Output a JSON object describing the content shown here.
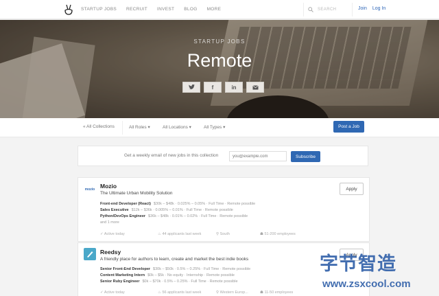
{
  "nav": {
    "links": [
      "STARTUP JOBS",
      "RECRUIT",
      "INVEST",
      "BLOG",
      "MORE"
    ],
    "search_placeholder": "SEARCH",
    "join": "Join",
    "login": "Log In"
  },
  "hero": {
    "subtitle": "STARTUP JOBS",
    "title": "Remote",
    "share": [
      "twitter",
      "facebook",
      "linkedin",
      "email"
    ]
  },
  "filters": {
    "all_collections": "« All Collections",
    "roles": "All Roles",
    "locations": "All Locations",
    "types": "All Types",
    "post_job": "Post a Job"
  },
  "subscribe": {
    "text": "Get a weekly email of new jobs in this collection",
    "placeholder": "you@example.com",
    "button": "Subscribe"
  },
  "companies": [
    {
      "name": "Mozio",
      "logo_text": "mozio",
      "tagline": "The Ultimate Urban Mobility Solution",
      "apply": "Apply",
      "jobs": [
        {
          "title": "Front-end Developer (React)",
          "details": "$30k – $48k · 0.025% – 0.05% · Full Time · Remote possible"
        },
        {
          "title": "Sales Executive",
          "details": "$12k – $36k · 0.005% – 0.01% · Full Time · Remote possible"
        },
        {
          "title": "Python/DevOps Engineer",
          "details": "$36k – $48k · 0.01% – 0.02% · Full Time · Remote possible"
        }
      ],
      "more": "and 1 more",
      "meta": {
        "activity": "Active today",
        "applicants": "44 applicants last week",
        "location": "South",
        "size": "51-200 employees"
      }
    },
    {
      "name": "Reedsy",
      "tagline": "A friendly place for authors to learn, create and market the best indie books",
      "apply": "Apply",
      "jobs": [
        {
          "title": "Senior Front-End Developer",
          "details": "$30k – $50k · 0.5% – 0.25% · Full Time · Remote possible"
        },
        {
          "title": "Content Marketing Intern",
          "details": "$0k – $5k · No equity · Internship · Remote possible"
        },
        {
          "title": "Senior Ruby Engineer",
          "details": "$0k – $70k · 0.5% – 0.25% · Full Time · Remote possible"
        }
      ],
      "meta": {
        "activity": "Active today",
        "applicants": "56 applicants last week",
        "location": "Western Europ...",
        "size": "11-50 employees"
      }
    }
  ],
  "watermark": {
    "line1": "字节智造",
    "line2": "www.zsxcool.com"
  },
  "colors": {
    "accent": "#2f68b3",
    "link": "#2e66b8"
  }
}
